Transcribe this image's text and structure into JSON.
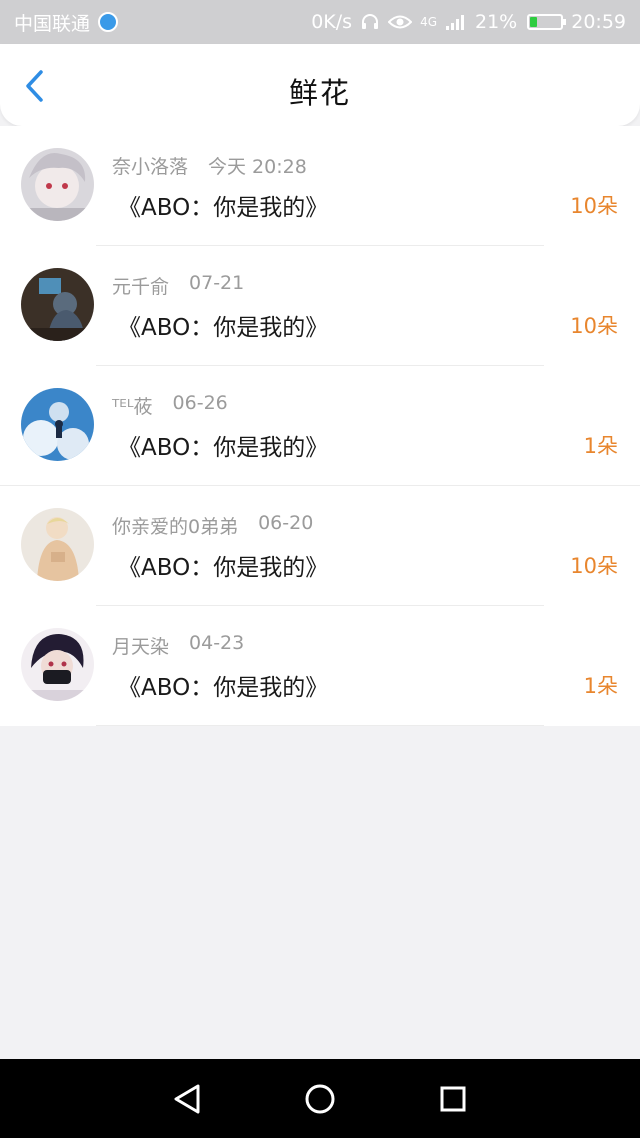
{
  "status_bar": {
    "carrier": "中国联通",
    "speed": "0K/s",
    "network": "4G",
    "battery": "21%",
    "battery_level": 0.21,
    "time": "20:59"
  },
  "header": {
    "title": "鲜花"
  },
  "items": [
    {
      "name": "奈小洛落",
      "time": "今天 20:28",
      "book": "《ABO：你是我的》",
      "count": "10朵"
    },
    {
      "name": "元千俞",
      "time": "07-21",
      "book": "《ABO：你是我的》",
      "count": "10朵"
    },
    {
      "name": "ᵀᴱᴸ莜",
      "time": "06-26",
      "book": "《ABO：你是我的》",
      "count": "1朵"
    },
    {
      "name": "你亲爱的0弟弟",
      "time": "06-20",
      "book": "《ABO：你是我的》",
      "count": "10朵"
    },
    {
      "name": "月天染",
      "time": "04-23",
      "book": "《ABO：你是我的》",
      "count": "1朵"
    }
  ],
  "colors": {
    "accent": "#2f8de4",
    "count": "#e8862e",
    "status_bar": "#cfcfd1"
  }
}
